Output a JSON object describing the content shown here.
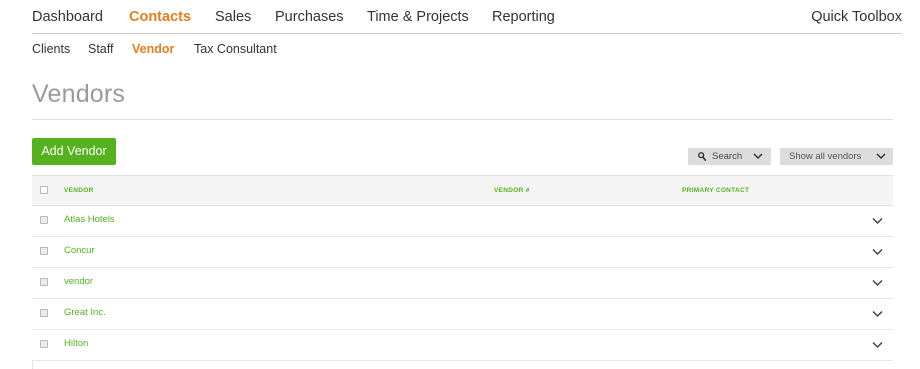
{
  "topnav": {
    "items": [
      {
        "label": "Dashboard",
        "active": false
      },
      {
        "label": "Contacts",
        "active": true
      },
      {
        "label": "Sales",
        "active": false
      },
      {
        "label": "Purchases",
        "active": false
      },
      {
        "label": "Time & Projects",
        "active": false
      },
      {
        "label": "Reporting",
        "active": false
      }
    ],
    "toolbox_label": "Quick Toolbox"
  },
  "subnav": {
    "items": [
      {
        "label": "Clients",
        "active": false
      },
      {
        "label": "Staff",
        "active": false
      },
      {
        "label": "Vendor",
        "active": true
      },
      {
        "label": "Tax Consultant",
        "active": false
      }
    ]
  },
  "page": {
    "title": "Vendors",
    "add_button_label": "Add Vendor"
  },
  "filters": {
    "search_label": "Search",
    "search_icon": "magnifier-icon",
    "show_label": "Show all vendors",
    "dropdown_icon": "chevron-down-icon"
  },
  "table": {
    "columns": [
      "Vendor",
      "Vendor #",
      "Primary Contact"
    ],
    "rows": [
      {
        "vendor": "Atlas Hotels",
        "vendor_number": "",
        "primary_contact": ""
      },
      {
        "vendor": "Concur",
        "vendor_number": "",
        "primary_contact": ""
      },
      {
        "vendor": "vendor",
        "vendor_number": "",
        "primary_contact": ""
      },
      {
        "vendor": "Great Inc.",
        "vendor_number": "",
        "primary_contact": ""
      },
      {
        "vendor": "Hilton",
        "vendor_number": "",
        "primary_contact": ""
      }
    ],
    "row_expand_icon": "chevron-down-icon"
  },
  "colors": {
    "accent_orange": "#e87d1e",
    "brand_green": "#55b21e",
    "title_gray": "#9a9a9a",
    "filter_gray": "#dcdcdc"
  }
}
